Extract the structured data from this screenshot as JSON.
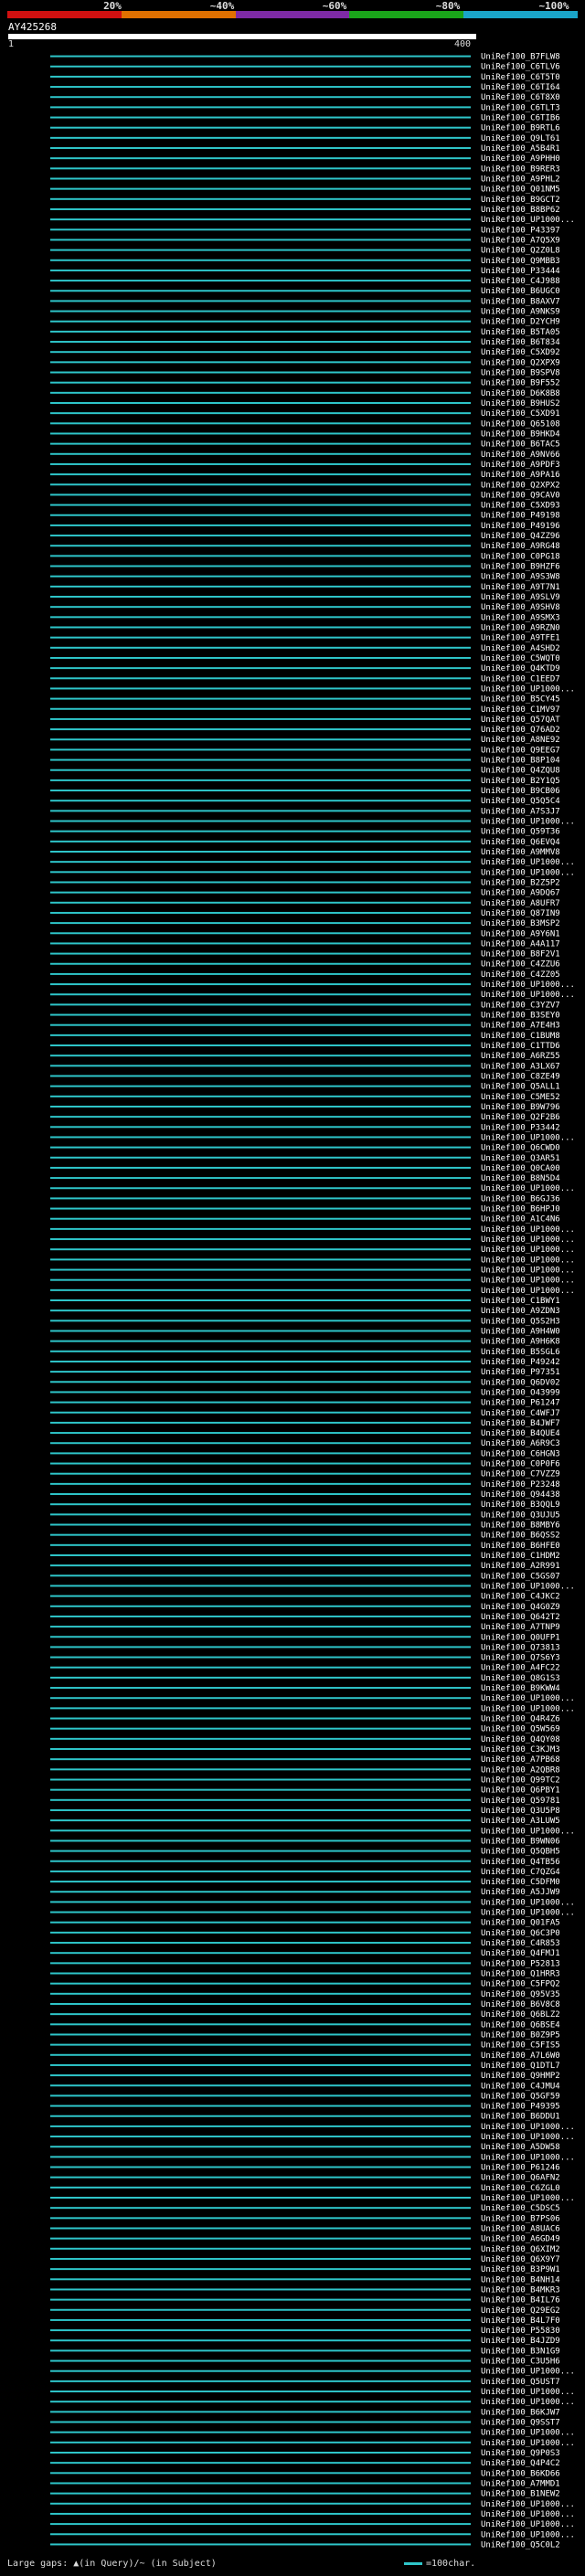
{
  "header": {
    "percent_labels": [
      "20%",
      "~40%",
      "~60%",
      "~80%",
      "~100%"
    ],
    "scale_colors": [
      "#d11010",
      "#e07000",
      "#7e2aa6",
      "#1aa51a",
      "#1aa5c9"
    ],
    "query_id": "AY425268",
    "ruler_start": "1",
    "ruler_end": "400"
  },
  "colors": {
    "alignment": "#2ec5c9",
    "gap": "#ffffff"
  },
  "footer": {
    "gaps_text": "Large gaps: ▲(in Query)/~ (in Subject)",
    "scale_text": "=100char."
  },
  "hits": [
    "UniRef100_B7FLW8",
    "UniRef100_C6TLV6",
    "UniRef100_C6T5T0",
    "UniRef100_C6TI64",
    "UniRef100_C6T8X0",
    "UniRef100_C6TLT3",
    "UniRef100_C6TIB6",
    "UniRef100_B9RTL6",
    "UniRef100_Q9LT61",
    "UniRef100_A5B4R1",
    "UniRef100_A9PHH0",
    "UniRef100_B9RER3",
    "UniRef100_A9PHL2",
    "UniRef100_Q01NM5",
    "UniRef100_B9GCT2",
    "UniRef100_B8BP62",
    "UniRef100_UP1000...",
    "UniRef100_P43397",
    "UniRef100_A7Q5X9",
    "UniRef100_Q2Z0L8",
    "UniRef100_Q9MBB3",
    "UniRef100_P33444",
    "UniRef100_C4J988",
    "UniRef100_B6UGC0",
    "UniRef100_B8AXV7",
    "UniRef100_A9NKS9",
    "UniRef100_D2YCH9",
    "UniRef100_B5TA05",
    "UniRef100_B6T834",
    "UniRef100_C5XD92",
    "UniRef100_Q2XPX9",
    "UniRef100_B9SPV8",
    "UniRef100_B9F552",
    "UniRef100_D6K8B8",
    "UniRef100_B9HUS2",
    "UniRef100_C5XD91",
    "UniRef100_Q65108",
    "UniRef100_B9HKD4",
    "UniRef100_B6TAC5",
    "UniRef100_A9NV66",
    "UniRef100_A9PDF3",
    "UniRef100_A9PA16",
    "UniRef100_Q2XPX2",
    "UniRef100_Q9CAV0",
    "UniRef100_C5XD93",
    "UniRef100_P49198",
    "UniRef100_P49196",
    "UniRef100_Q4ZZ96",
    "UniRef100_A9RG48",
    "UniRef100_C0PG18",
    "UniRef100_B9HZF6",
    "UniRef100_A9S3W8",
    "UniRef100_A9T7N1",
    "UniRef100_A9SLV9",
    "UniRef100_A9SHV8",
    "UniRef100_A9SMX3",
    "UniRef100_A9RZN0",
    "UniRef100_A9TFE1",
    "UniRef100_A4SHD2",
    "UniRef100_C5WQT0",
    "UniRef100_Q4KTD9",
    "UniRef100_C1EED7",
    "UniRef100_UP1000...",
    "UniRef100_B5CY45",
    "UniRef100_C1MV97",
    "UniRef100_Q57QAT",
    "UniRef100_Q76AD2",
    "UniRef100_A8NE92",
    "UniRef100_Q9EEG7",
    "UniRef100_B8P104",
    "UniRef100_Q4ZQU8",
    "UniRef100_B2Y1Q5",
    "UniRef100_B9CB06",
    "UniRef100_Q5Q5C4",
    "UniRef100_A7S3J7",
    "UniRef100_UP1000...",
    "UniRef100_Q59T36",
    "UniRef100_Q6EVQ4",
    "UniRef100_A9MMV8",
    "UniRef100_UP1000...",
    "UniRef100_UP1000...",
    "UniRef100_B2Z5P2",
    "UniRef100_A9DQ67",
    "UniRef100_A8UFR7",
    "UniRef100_Q87IN9",
    "UniRef100_B3MSP2",
    "UniRef100_A9Y6N1",
    "UniRef100_A4A117",
    "UniRef100_B8F2V1",
    "UniRef100_C4ZZU6",
    "UniRef100_C4ZZ05",
    "UniRef100_UP1000...",
    "UniRef100_UP1000...",
    "UniRef100_C3YZV7",
    "UniRef100_B3SEY0",
    "UniRef100_A7E4H3",
    "UniRef100_C1BUM8",
    "UniRef100_C1TTD6",
    "UniRef100_A6RZ55",
    "UniRef100_A3LX67",
    "UniRef100_C8ZE49",
    "UniRef100_Q5ALL1",
    "UniRef100_C5ME52",
    "UniRef100_B9W796",
    "UniRef100_Q2F2B6",
    "UniRef100_P33442",
    "UniRef100_UP1000...",
    "UniRef100_Q6CWD0",
    "UniRef100_Q3AR51",
    "UniRef100_Q0CA00",
    "UniRef100_B8N5D4",
    "UniRef100_UP1000...",
    "UniRef100_B6GJ36",
    "UniRef100_B6HPJ0",
    "UniRef100_A1C4N6",
    "UniRef100_UP1000...",
    "UniRef100_UP1000...",
    "UniRef100_UP1000...",
    "UniRef100_UP1000...",
    "UniRef100_UP1000...",
    "UniRef100_UP1000...",
    "UniRef100_UP1000...",
    "UniRef100_C1BWY1",
    "UniRef100_A9ZDN3",
    "UniRef100_Q5S2H3",
    "UniRef100_A9H4W0",
    "UniRef100_A9H6K8",
    "UniRef100_B5SGL6",
    "UniRef100_P49242",
    "UniRef100_P97351",
    "UniRef100_Q6DV02",
    "UniRef100_O43999",
    "UniRef100_P61247",
    "UniRef100_C4WFJ7",
    "UniRef100_B4JWF7",
    "UniRef100_B4QUE4",
    "UniRef100_A6R9C3",
    "UniRef100_C6HGN3",
    "UniRef100_C0P0F6",
    "UniRef100_C7VZZ9",
    "UniRef100_P23248",
    "UniRef100_Q94438",
    "UniRef100_B3QQL9",
    "UniRef100_Q3UJU5",
    "UniRef100_B8MBY6",
    "UniRef100_B6QSS2",
    "UniRef100_B6HFE0",
    "UniRef100_C1HDM2",
    "UniRef100_A2R991",
    "UniRef100_C5GS07",
    "UniRef100_UP1000...",
    "UniRef100_C4JKC2",
    "UniRef100_Q4G0Z9",
    "UniRef100_Q642T2",
    "UniRef100_A7TNP9",
    "UniRef100_Q0UFP1",
    "UniRef100_Q73813",
    "UniRef100_Q7S6Y3",
    "UniRef100_A4FC22",
    "UniRef100_Q8G1S3",
    "UniRef100_B9KWW4",
    "UniRef100_UP1000...",
    "UniRef100_UP1000...",
    "UniRef100_Q4R4Z6",
    "UniRef100_Q5W569",
    "UniRef100_Q4QY08",
    "UniRef100_C3KJM3",
    "UniRef100_A7PB68",
    "UniRef100_A2QBR8",
    "UniRef100_Q99TC2",
    "UniRef100_Q6PBY1",
    "UniRef100_Q59781",
    "UniRef100_Q3U5P8",
    "UniRef100_A3LUW5",
    "UniRef100_UP1000...",
    "UniRef100_B9WN06",
    "UniRef100_Q5QBH5",
    "UniRef100_Q4TB56",
    "UniRef100_C7QZG4",
    "UniRef100_C5DFM0",
    "UniRef100_A5JJW9",
    "UniRef100_UP1000...",
    "UniRef100_UP1000...",
    "UniRef100_Q01FA5",
    "UniRef100_Q6C3P0",
    "UniRef100_C4R853",
    "UniRef100_Q4FMJ1",
    "UniRef100_P52813",
    "UniRef100_Q1HRR3",
    "UniRef100_C5FPQ2",
    "UniRef100_Q95V35",
    "UniRef100_B6V8C8",
    "UniRef100_Q6BLZ2",
    "UniRef100_Q6BSE4",
    "UniRef100_B0Z9P5",
    "UniRef100_C5FIS5",
    "UniRef100_A7L6W0",
    "UniRef100_Q1DTL7",
    "UniRef100_Q9HMP2",
    "UniRef100_C4JMU4",
    "UniRef100_Q5GF59",
    "UniRef100_P49395",
    "UniRef100_B6DDU1",
    "UniRef100_UP1000...",
    "UniRef100_UP1000...",
    "UniRef100_A5DW58",
    "UniRef100_UP1000...",
    "UniRef100_P61246",
    "UniRef100_Q6AFN2",
    "UniRef100_C6ZGL0",
    "UniRef100_UP1000...",
    "UniRef100_C5DSC5",
    "UniRef100_B7PS06",
    "UniRef100_A8UAC6",
    "UniRef100_A6GD49",
    "UniRef100_Q6XIM2",
    "UniRef100_Q6X9Y7",
    "UniRef100_B3P9W1",
    "UniRef100_B4NH14",
    "UniRef100_B4MKR3",
    "UniRef100_B4IL76",
    "UniRef100_Q29EG2",
    "UniRef100_B4L7F0",
    "UniRef100_P55830",
    "UniRef100_B4JZD9",
    "UniRef100_B3N1G9",
    "UniRef100_C3U5H6",
    "UniRef100_UP1000...",
    "UniRef100_Q5UST7",
    "UniRef100_UP1000...",
    "UniRef100_UP1000...",
    "UniRef100_B6KJW7",
    "UniRef100_Q9SST7",
    "UniRef100_UP1000...",
    "UniRef100_UP1000...",
    "UniRef100_Q9P0S3",
    "UniRef100_Q4P4C2",
    "UniRef100_B6KD66",
    "UniRef100_A7MMD1",
    "UniRef100_B1NEW2",
    "UniRef100_UP1000...",
    "UniRef100_UP1000...",
    "UniRef100_UP1000...",
    "UniRef100_UP1000...",
    "UniRef100_Q5C0L2"
  ]
}
